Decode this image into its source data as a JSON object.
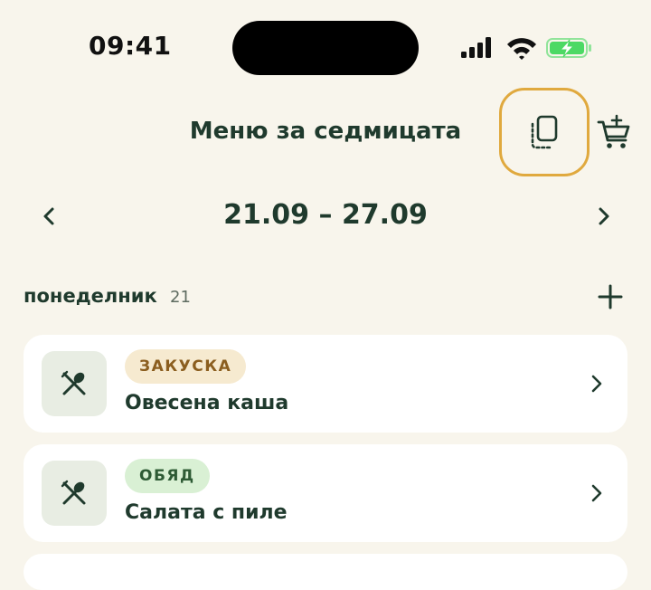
{
  "status_bar": {
    "time": "09:41"
  },
  "header": {
    "title": "Меню за седмицата",
    "copy_icon": "copy-week-icon",
    "cart_icon": "add-to-cart-icon"
  },
  "week": {
    "range": "21.09 – 27.09"
  },
  "day": {
    "name": "понеделник",
    "number": "21"
  },
  "meals": [
    {
      "category": "ЗАКУСКА",
      "name": "Овесена каша",
      "badge_bg": "#f6ead0",
      "badge_color": "#8b5e1f"
    },
    {
      "category": "ОБЯД",
      "name": "Салата с пиле",
      "badge_bg": "#d9f0d4",
      "badge_color": "#2e5b35"
    }
  ],
  "colors": {
    "background": "#f8f5ec",
    "primary_text": "#1f3a2d",
    "highlight_ring": "#e0a93e",
    "battery_green": "#4cd964"
  }
}
